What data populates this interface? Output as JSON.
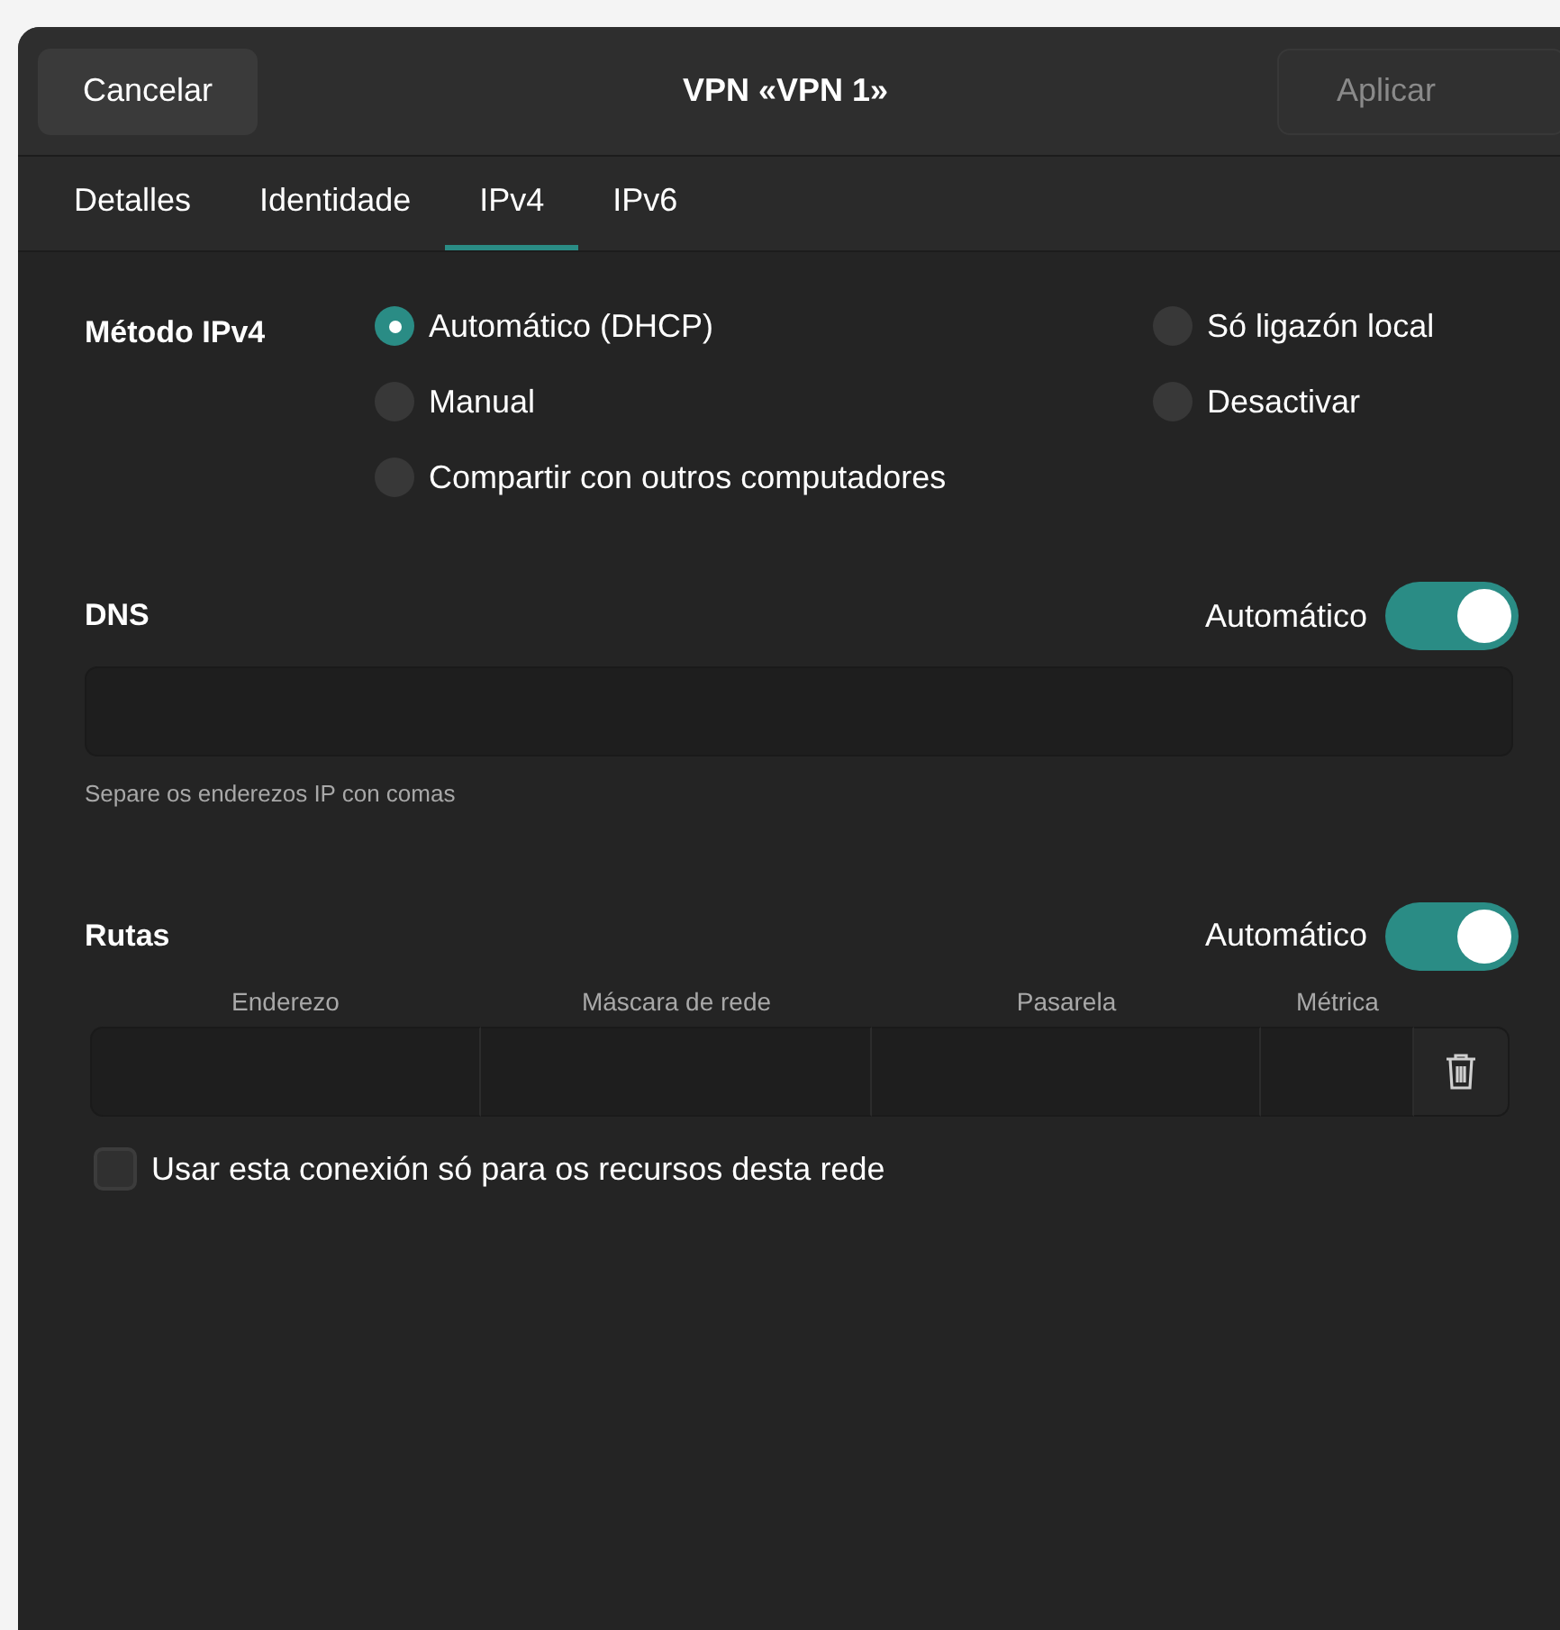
{
  "header": {
    "cancel": "Cancelar",
    "title": "VPN «VPN 1»",
    "apply": "Aplicar",
    "apply_disabled": true
  },
  "tabs": [
    {
      "label": "Detalles",
      "selected": false
    },
    {
      "label": "Identidade",
      "selected": false
    },
    {
      "label": "IPv4",
      "selected": true
    },
    {
      "label": "IPv6",
      "selected": false
    }
  ],
  "method": {
    "label": "Método IPv4",
    "options": [
      {
        "label": "Automático (DHCP)",
        "selected": true
      },
      {
        "label": "Só ligazón local",
        "selected": false
      },
      {
        "label": "Manual",
        "selected": false
      },
      {
        "label": "Desactivar",
        "selected": false
      },
      {
        "label": "Compartir con outros computadores",
        "selected": false
      }
    ]
  },
  "dns": {
    "label": "DNS",
    "auto_label": "Automático",
    "on": true,
    "hint": "Separe os enderezos IP con comas"
  },
  "routes": {
    "label": "Rutas",
    "auto_label": "Automático",
    "on": true,
    "columns": [
      "Enderezo",
      "Máscara de rede",
      "Pasarela",
      "Métrica"
    ]
  },
  "only_local": {
    "label": "Usar esta conexión só para os recursos desta rede",
    "checked": false
  }
}
